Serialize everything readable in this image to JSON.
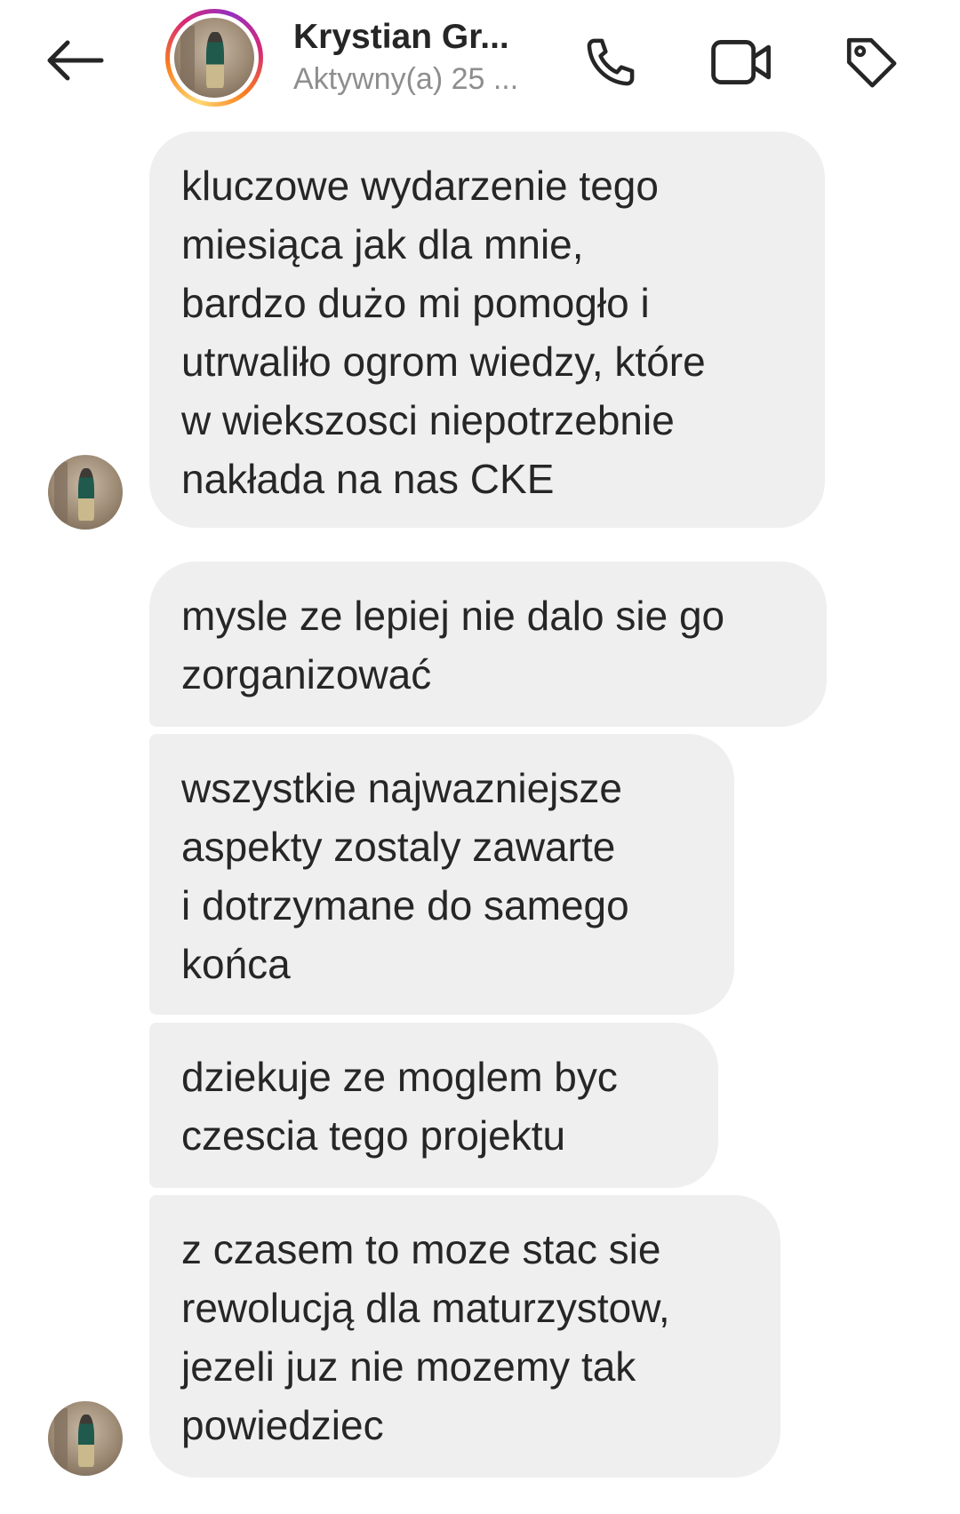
{
  "header": {
    "contact_name": "Krystian Gr...",
    "status": "Aktywny(a) 25 ...",
    "icons": {
      "back": "arrow-left-icon",
      "call": "phone-icon",
      "video": "video-camera-icon",
      "tag": "tag-icon"
    }
  },
  "messages": [
    {
      "text": "kluczowe wydarzenie tego\nmiesiąca jak dla mnie,\nbardzo dużo mi pomogło i\nutrwaliło ogrom wiedzy, które\nw wiekszosci niepotrzebnie\nnakłada na nas CKE"
    },
    {
      "text": "mysle ze lepiej nie dalo sie go\nzorganizować"
    },
    {
      "text": "wszystkie najwazniejsze\naspekty zostaly zawarte\ni dotrzymane do samego\nkońca"
    },
    {
      "text": "dziekuje ze moglem byc\nczescia tego projektu"
    },
    {
      "text": "z czasem to moze stac sie\nrewolucją dla maturzystow,\njezeli juz nie mozemy tak\npowiedziec"
    }
  ],
  "colors": {
    "bubble_bg": "#efefef",
    "text": "#262626",
    "status_text": "#8e8e8e",
    "story_ring": [
      "#feda75",
      "#fa7e1e",
      "#d62976",
      "#962fbf"
    ]
  }
}
